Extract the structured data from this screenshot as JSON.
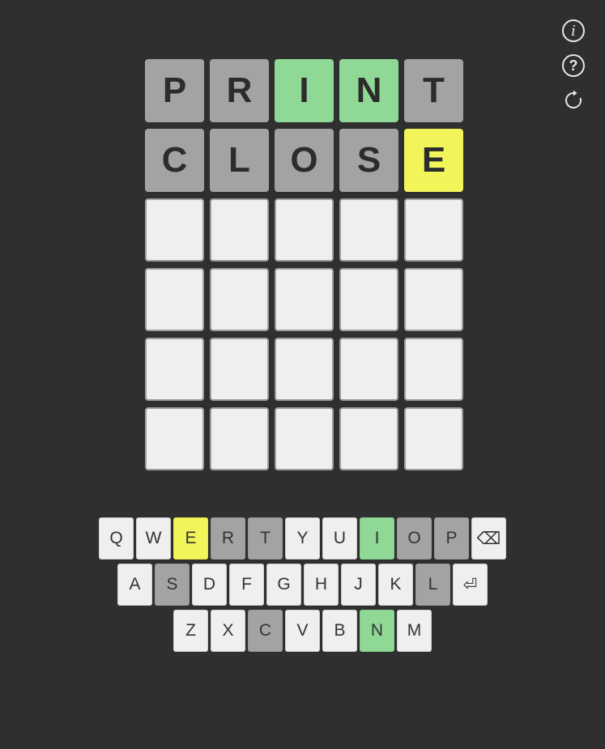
{
  "colors": {
    "background": "#2f2f2f",
    "empty_tile": "#efefef",
    "absent": "#a4a2a2",
    "correct": "#8fd896",
    "present": "#f2f55a"
  },
  "icons": [
    "info-icon",
    "help-icon",
    "refresh-icon"
  ],
  "header": {
    "info_glyph": "i",
    "help_glyph": "?"
  },
  "board": {
    "rows": [
      [
        {
          "letter": "P",
          "state": "absent"
        },
        {
          "letter": "R",
          "state": "absent"
        },
        {
          "letter": "I",
          "state": "correct"
        },
        {
          "letter": "N",
          "state": "correct"
        },
        {
          "letter": "T",
          "state": "absent"
        }
      ],
      [
        {
          "letter": "C",
          "state": "absent"
        },
        {
          "letter": "L",
          "state": "absent"
        },
        {
          "letter": "O",
          "state": "absent"
        },
        {
          "letter": "S",
          "state": "absent"
        },
        {
          "letter": "E",
          "state": "present"
        }
      ],
      [
        {
          "letter": "",
          "state": "empty"
        },
        {
          "letter": "",
          "state": "empty"
        },
        {
          "letter": "",
          "state": "empty"
        },
        {
          "letter": "",
          "state": "empty"
        },
        {
          "letter": "",
          "state": "empty"
        }
      ],
      [
        {
          "letter": "",
          "state": "empty"
        },
        {
          "letter": "",
          "state": "empty"
        },
        {
          "letter": "",
          "state": "empty"
        },
        {
          "letter": "",
          "state": "empty"
        },
        {
          "letter": "",
          "state": "empty"
        }
      ],
      [
        {
          "letter": "",
          "state": "empty"
        },
        {
          "letter": "",
          "state": "empty"
        },
        {
          "letter": "",
          "state": "empty"
        },
        {
          "letter": "",
          "state": "empty"
        },
        {
          "letter": "",
          "state": "empty"
        }
      ],
      [
        {
          "letter": "",
          "state": "empty"
        },
        {
          "letter": "",
          "state": "empty"
        },
        {
          "letter": "",
          "state": "empty"
        },
        {
          "letter": "",
          "state": "empty"
        },
        {
          "letter": "",
          "state": "empty"
        }
      ]
    ]
  },
  "keyboard": {
    "rows": [
      [
        {
          "label": "Q",
          "state": "unused"
        },
        {
          "label": "W",
          "state": "unused"
        },
        {
          "label": "E",
          "state": "present"
        },
        {
          "label": "R",
          "state": "absent"
        },
        {
          "label": "T",
          "state": "absent"
        },
        {
          "label": "Y",
          "state": "unused"
        },
        {
          "label": "U",
          "state": "unused"
        },
        {
          "label": "I",
          "state": "correct"
        },
        {
          "label": "O",
          "state": "absent"
        },
        {
          "label": "P",
          "state": "absent"
        },
        {
          "label": "⌫",
          "state": "unused",
          "name": "backspace-key"
        }
      ],
      [
        {
          "label": "A",
          "state": "unused"
        },
        {
          "label": "S",
          "state": "absent"
        },
        {
          "label": "D",
          "state": "unused"
        },
        {
          "label": "F",
          "state": "unused"
        },
        {
          "label": "G",
          "state": "unused"
        },
        {
          "label": "H",
          "state": "unused"
        },
        {
          "label": "J",
          "state": "unused"
        },
        {
          "label": "K",
          "state": "unused"
        },
        {
          "label": "L",
          "state": "absent"
        },
        {
          "label": "⏎",
          "state": "unused",
          "name": "enter-key"
        }
      ],
      [
        {
          "label": "Z",
          "state": "unused"
        },
        {
          "label": "X",
          "state": "unused"
        },
        {
          "label": "C",
          "state": "absent"
        },
        {
          "label": "V",
          "state": "unused"
        },
        {
          "label": "B",
          "state": "unused"
        },
        {
          "label": "N",
          "state": "correct"
        },
        {
          "label": "M",
          "state": "unused"
        }
      ]
    ]
  }
}
